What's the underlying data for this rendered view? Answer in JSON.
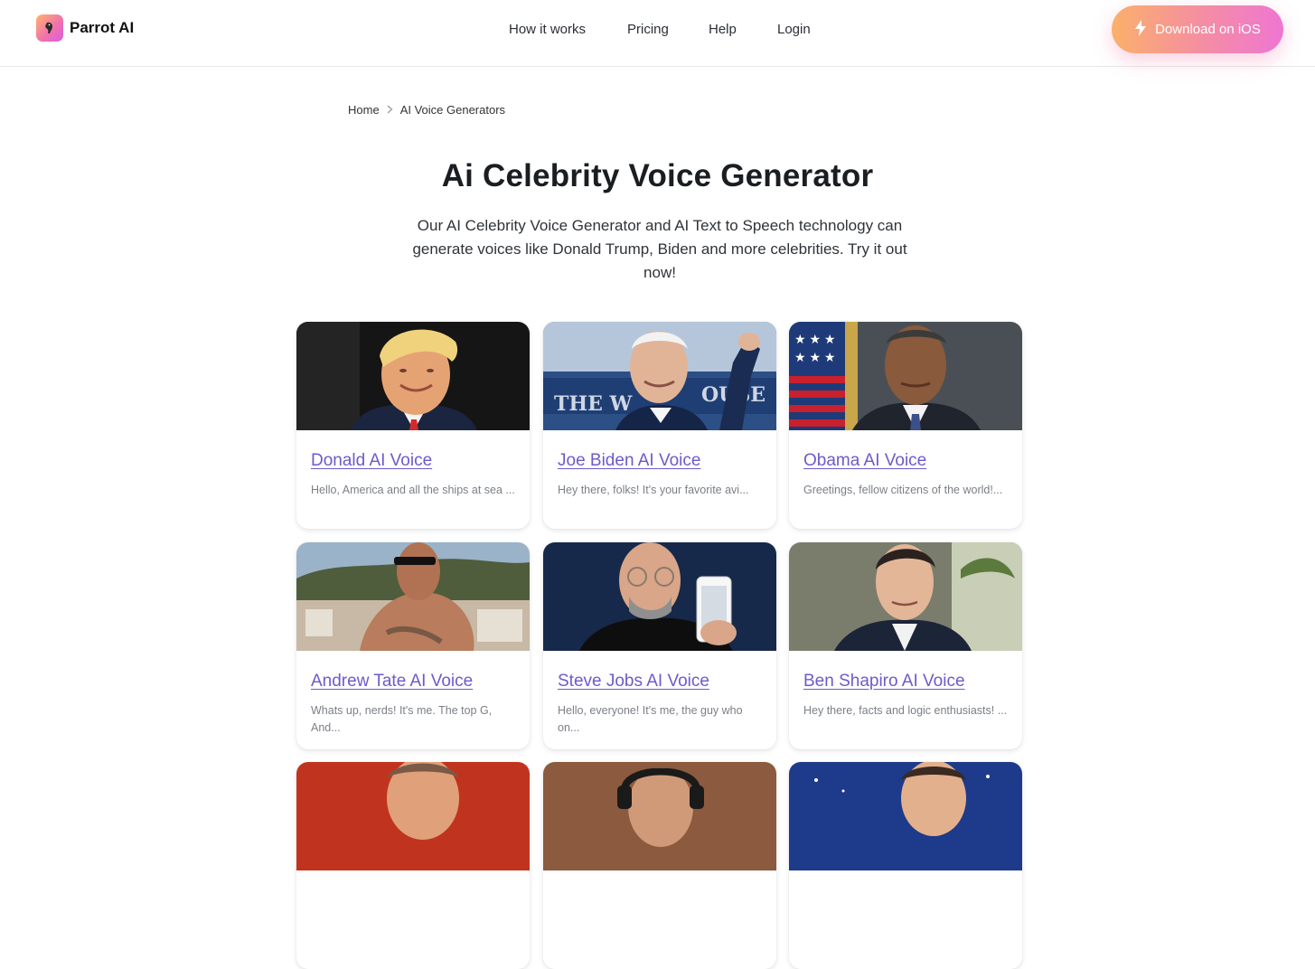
{
  "brand": {
    "name": "Parrot AI"
  },
  "nav": {
    "items": [
      {
        "label": "How it works"
      },
      {
        "label": "Pricing"
      },
      {
        "label": "Help"
      },
      {
        "label": "Login"
      }
    ],
    "cta_label": "Download on iOS"
  },
  "breadcrumb": {
    "home": "Home",
    "current": "AI Voice Generators"
  },
  "page": {
    "title": "Ai Celebrity Voice Generator",
    "subtitle": "Our AI Celebrity Voice Generator and AI Text to Speech technology can generate voices like Donald Trump, Biden and more celebrities. Try it out now!"
  },
  "colors": {
    "accent_link": "#6b5cc9",
    "cta_gradient_start": "#fbb06a",
    "cta_gradient_end": "#ee76d2"
  },
  "cards": [
    {
      "title": "Donald AI Voice",
      "desc": "Hello, America and all the ships at sea ..."
    },
    {
      "title": "Joe Biden AI Voice",
      "desc": "Hey there, folks! It's your favorite avi..."
    },
    {
      "title": "Obama AI Voice",
      "desc": "Greetings, fellow citizens of the world!..."
    },
    {
      "title": "Andrew Tate AI Voice",
      "desc": "Whats up, nerds! It's me. The top G, And..."
    },
    {
      "title": "Steve Jobs AI Voice",
      "desc": "Hello, everyone! It's me, the guy who on..."
    },
    {
      "title": "Ben Shapiro AI Voice",
      "desc": "Hey there, facts and logic enthusiasts! ..."
    },
    {
      "title": "",
      "desc": ""
    },
    {
      "title": "",
      "desc": ""
    },
    {
      "title": "",
      "desc": ""
    }
  ]
}
